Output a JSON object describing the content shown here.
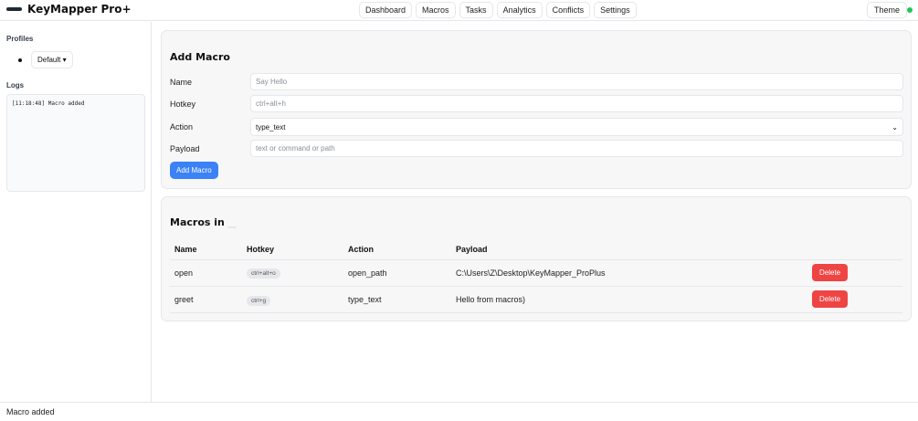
{
  "app": {
    "title": "KeyMapper Pro+",
    "status_color": "#22c55e",
    "accent_color": "#3b82f6",
    "danger_color": "#ef4444"
  },
  "nav": {
    "items": [
      "Dashboard",
      "Macros",
      "Tasks",
      "Analytics",
      "Conflicts",
      "Settings"
    ],
    "theme_label": "Theme"
  },
  "sidebar": {
    "profiles_heading": "Profiles",
    "profile_name": "Default",
    "logs_heading": "Logs",
    "log_lines": [
      "[11:18:48] Macro added"
    ]
  },
  "add_macro": {
    "title": "Add Macro",
    "name_label": "Name",
    "name_placeholder": "Say Hello",
    "hotkey_label": "Hotkey",
    "hotkey_placeholder": "ctrl+alt+h",
    "action_label": "Action",
    "action_value": "type_text",
    "payload_label": "Payload",
    "payload_placeholder": "text or command or path",
    "submit_label": "Add Macro"
  },
  "macros": {
    "title": "Macros in",
    "headers": [
      "Name",
      "Hotkey",
      "Action",
      "Payload"
    ],
    "rows": [
      {
        "name": "open",
        "hotkey": "ctrl+alt+o",
        "action": "open_path",
        "payload": "C:\\Users\\Z\\Desktop\\KeyMapper_ProPlus",
        "delete_label": "Delete"
      },
      {
        "name": "greet",
        "hotkey": "ctrl+g",
        "action": "type_text",
        "payload": "Hello from macros)",
        "delete_label": "Delete"
      }
    ]
  },
  "statusbar": {
    "text": "Macro added"
  }
}
